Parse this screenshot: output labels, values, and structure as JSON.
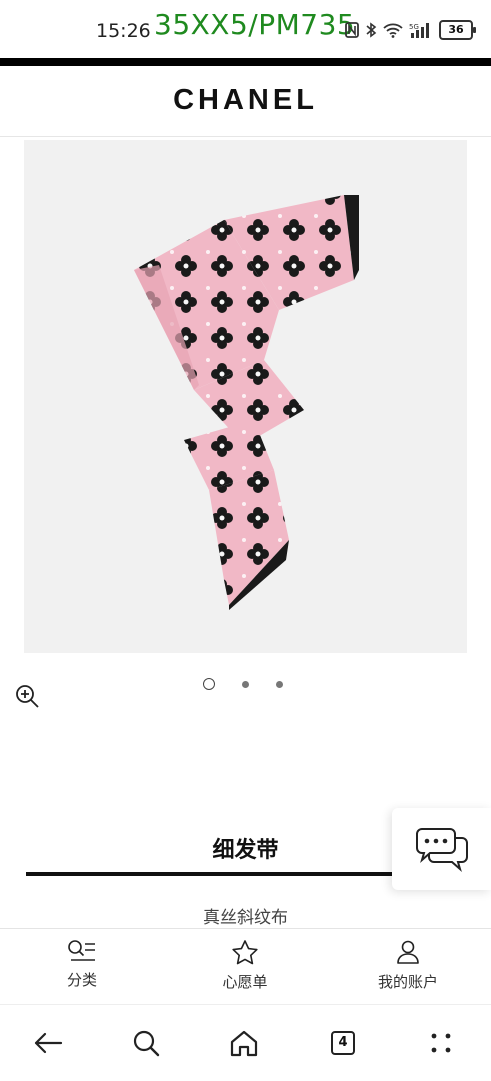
{
  "status_bar": {
    "time": "15:26",
    "overlay_text": "35XX5/PM735",
    "battery": "36",
    "icons": [
      "nfc-icon",
      "bluetooth-icon",
      "wifi-icon",
      "5g-signal-icon",
      "battery-icon"
    ]
  },
  "header": {
    "brand": "CHANEL"
  },
  "product": {
    "image": {
      "description_icon": "scarf-image",
      "colors": {
        "pink": "#f1b8c6",
        "black": "#1a1a1a",
        "background": "#f1f1f1"
      }
    },
    "carousel": {
      "count": 3,
      "active_index": 0
    },
    "title": "细发带",
    "subtitle": "真丝斜纹布"
  },
  "bottom_nav": {
    "items": [
      {
        "label": "分类",
        "icon": "category-search-icon"
      },
      {
        "label": "心愿单",
        "icon": "star-icon"
      },
      {
        "label": "我的账户",
        "icon": "person-icon"
      }
    ]
  },
  "browser_bar": {
    "tab_count": "4",
    "icons": [
      "back-arrow-icon",
      "search-icon",
      "home-icon",
      "tabs-icon",
      "more-icon"
    ]
  }
}
